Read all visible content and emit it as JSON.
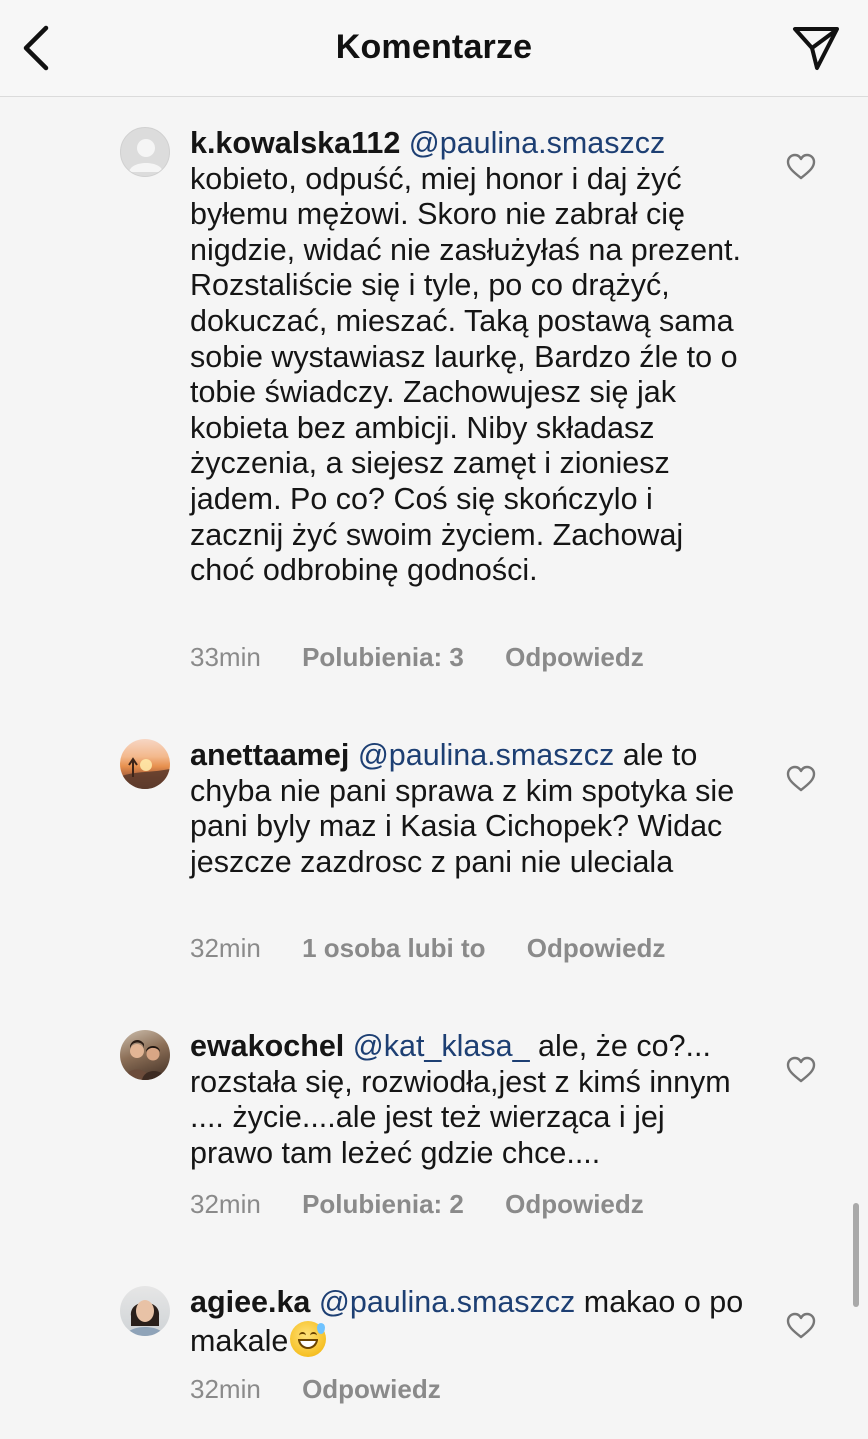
{
  "header": {
    "title": "Komentarze",
    "back_icon": "chevron-left-icon",
    "share_icon": "paper-plane-icon"
  },
  "comments": [
    {
      "username": "k.kowalska112",
      "mention": "@paulina.smaszcz",
      "text": "kobieto, odpuść, miej honor i daj żyć byłemu mężowi. Skoro nie zabrał cię nigdzie, widać nie zasłużyłaś na prezent. Rozstaliście się i tyle, po co drążyć, dokuczać, mieszać. Taką postawą sama sobie wystawiasz laurkę, Bardzo źle to o tobie świadczy. Zachowujesz się jak kobieta bez ambicji. Niby składasz życzenia, a siejesz zamęt i zioniesz jadem. Po co? Coś się skończylo i zacznij żyć swoim życiem. Zachowaj choć odbrobinę godności.",
      "time": "33min",
      "likes": "Polubienia: 3",
      "reply": "Odpowiedz"
    },
    {
      "username": "anettaamej",
      "mention": "@paulina.smaszcz",
      "text": "ale to chyba nie pani sprawa z kim spotyka sie pani byly maz i Kasia Cichopek? Widac jeszcze zazdrosc z pani nie uleciala",
      "time": "32min",
      "likes": "1 osoba lubi to",
      "reply": "Odpowiedz"
    },
    {
      "username": "ewakochel",
      "mention": "@kat_klasa_",
      "text": "ale, że co?... rozstała się, rozwiodła,jest z kimś innym .... życie....ale jest też wierząca i jej prawo tam leżeć gdzie chce....",
      "time": "32min",
      "likes": "Polubienia: 2",
      "reply": "Odpowiedz"
    },
    {
      "username": "agiee.ka",
      "mention": "@paulina.smaszcz",
      "text": "makao o po makale",
      "emoji": "grinning-sweat-emoji",
      "time": "32min",
      "reply": "Odpowiedz"
    }
  ],
  "colors": {
    "background": "#f5f5f5",
    "mention": "#1d3f73",
    "meta": "#8a8a8a",
    "text": "#151515"
  }
}
